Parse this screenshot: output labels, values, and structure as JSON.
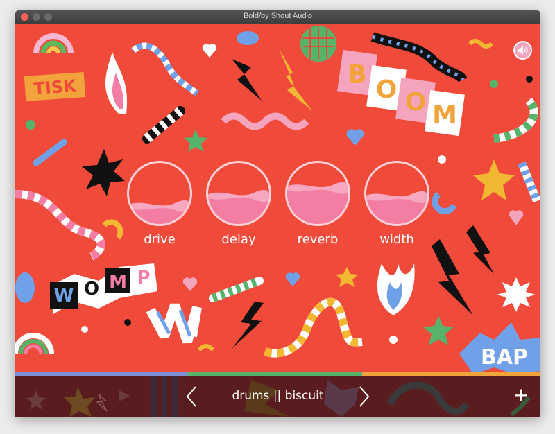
{
  "window": {
    "title": "Bold/by Shout Audio"
  },
  "stickers": {
    "tisk": "TISK",
    "boom": [
      "B",
      "O",
      "O",
      "M"
    ],
    "womp": [
      "W",
      "O",
      "M",
      "P"
    ],
    "bap": "BAP"
  },
  "knobs": [
    {
      "label": "drive",
      "level": 0.25
    },
    {
      "label": "delay",
      "level": 0.42
    },
    {
      "label": "reverb",
      "level": 0.55
    },
    {
      "label": "width",
      "level": 0.4
    }
  ],
  "preset": {
    "name": "drums || biscuit"
  },
  "controls": {
    "add": "+"
  },
  "colors": {
    "background": "#ef4a3a",
    "knob_fill": "#f47ea3",
    "bottom_bar": "#5a1d1f",
    "progress_fill": "#57b36a",
    "progress_base": "#7e8fd8",
    "progress_right": "#f2a33b"
  },
  "icons": {
    "speaker": "speaker-icon",
    "prev": "chevron-left-icon",
    "next": "chevron-right-icon",
    "add": "plus-icon"
  }
}
